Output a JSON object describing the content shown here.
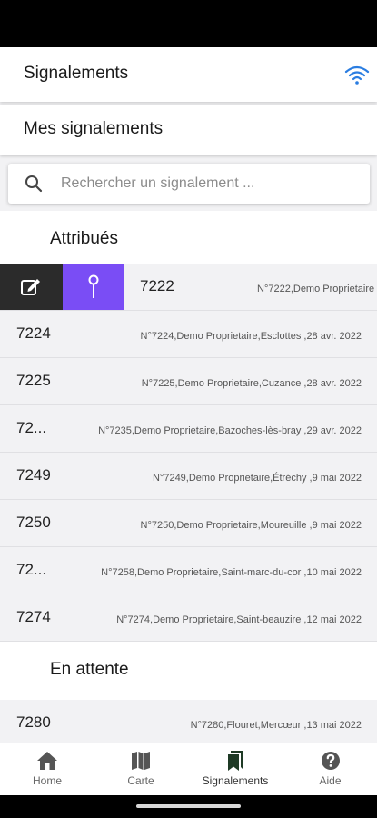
{
  "header": {
    "title": "Signalements",
    "wifi_icon": "wifi-icon",
    "wifi_color": "#2a7de1"
  },
  "section": {
    "title": "Mes signalements"
  },
  "search": {
    "placeholder": "Rechercher un signalement ..."
  },
  "groups": {
    "assigned": {
      "label": "Attribués"
    },
    "pending": {
      "label": "En attente"
    }
  },
  "swipe_actions": {
    "edit_icon": "edit-icon",
    "pin_icon": "pin-icon",
    "edit_color": "#2b2b2b",
    "pin_color": "#7a4df5"
  },
  "assigned_rows": [
    {
      "id": "7222",
      "desc": "N°7222,Demo Proprietaire"
    },
    {
      "id": "7224",
      "desc": "N°7224,Demo Proprietaire,Esclottes ,28 avr. 2022"
    },
    {
      "id": "7225",
      "desc": "N°7225,Demo Proprietaire,Cuzance ,28 avr. 2022"
    },
    {
      "id": "72...",
      "desc": "N°7235,Demo Proprietaire,Bazoches-lès-bray ,29 avr. 2022"
    },
    {
      "id": "7249",
      "desc": "N°7249,Demo Proprietaire,Étréchy ,9 mai 2022"
    },
    {
      "id": "7250",
      "desc": "N°7250,Demo Proprietaire,Moureuille ,9 mai 2022"
    },
    {
      "id": "72...",
      "desc": "N°7258,Demo Proprietaire,Saint-marc-du-cor ,10 mai 2022"
    },
    {
      "id": "7274",
      "desc": "N°7274,Demo Proprietaire,Saint-beauzire ,12 mai 2022"
    }
  ],
  "pending_rows": [
    {
      "id": "7280",
      "desc": "N°7280,Flouret,Mercœur ,13 mai 2022"
    }
  ],
  "nav": {
    "items": [
      {
        "label": "Home",
        "icon": "home-icon"
      },
      {
        "label": "Carte",
        "icon": "map-icon"
      },
      {
        "label": "Signalements",
        "icon": "bookmark-icon"
      },
      {
        "label": "Aide",
        "icon": "help-icon"
      }
    ],
    "active": "Signalements"
  }
}
